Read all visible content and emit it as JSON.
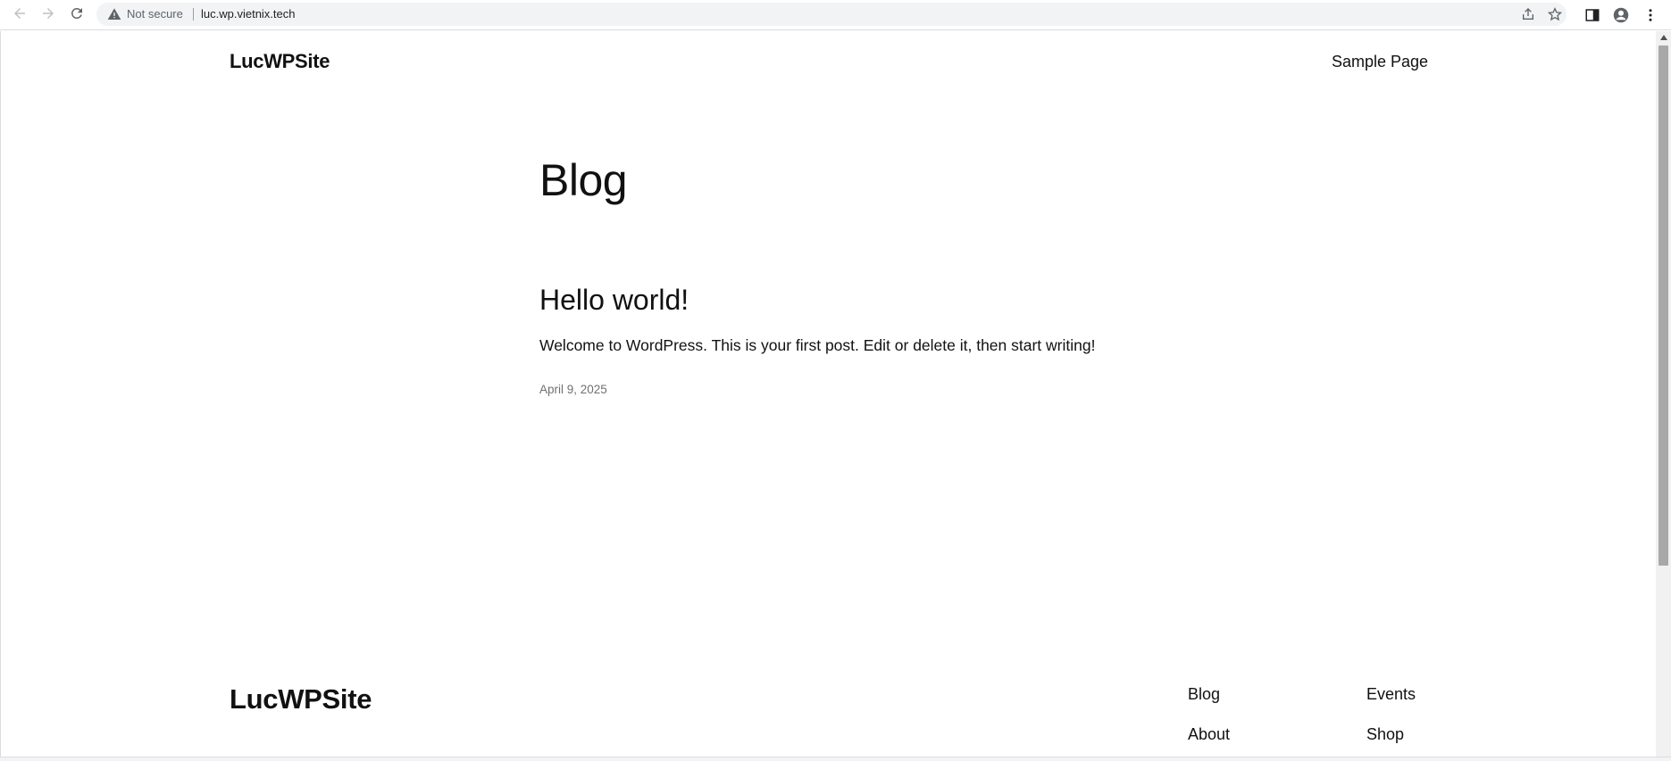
{
  "browser": {
    "security_label": "Not secure",
    "url": "luc.wp.vietnix.tech",
    "icons": {
      "back": "back-arrow-icon",
      "forward": "forward-arrow-icon",
      "reload": "reload-icon",
      "warning": "warning-triangle-icon",
      "share": "share-icon",
      "bookmark": "star-icon",
      "side_panel": "side-panel-icon",
      "profile": "profile-icon",
      "menu": "kebab-menu-icon"
    }
  },
  "header": {
    "site_title": "LucWPSite",
    "nav": [
      "Sample Page"
    ]
  },
  "main": {
    "page_title": "Blog",
    "posts": [
      {
        "title": "Hello world!",
        "excerpt": "Welcome to WordPress. This is your first post. Edit or delete it, then start writing!",
        "date": "April 9, 2025"
      }
    ]
  },
  "footer": {
    "site_title": "LucWPSite",
    "links": [
      "Blog",
      "Events",
      "About",
      "Shop"
    ]
  },
  "colors": {
    "text": "#111111",
    "muted": "#707070",
    "omnibox_bg": "#f1f3f4",
    "scrollbar_thumb": "#a8a8a8"
  }
}
